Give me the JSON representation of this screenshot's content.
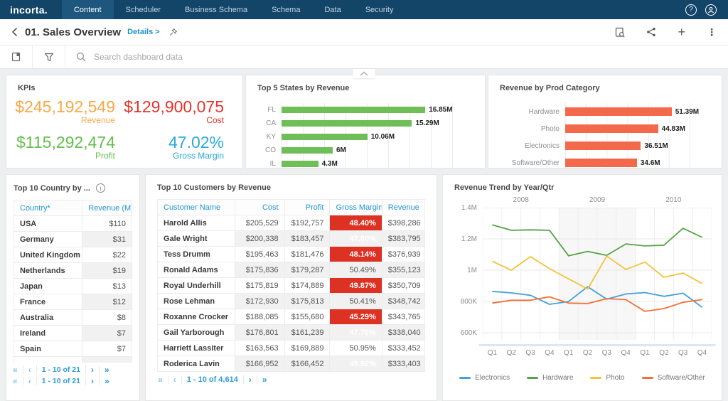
{
  "nav": {
    "logo": "incorta.",
    "items": [
      {
        "label": "Content",
        "active": true
      },
      {
        "label": "Scheduler",
        "active": false
      },
      {
        "label": "Business Schema",
        "active": false
      },
      {
        "label": "Schema",
        "active": false
      },
      {
        "label": "Data",
        "active": false
      },
      {
        "label": "Security",
        "active": false
      }
    ]
  },
  "icons": {
    "help_glyph": "?",
    "add_glyph": "+",
    "more_glyph": "⋮",
    "info_glyph": "i",
    "collapse_direction": "up"
  },
  "header": {
    "title": "01. Sales Overview",
    "details_label": "Details >"
  },
  "toolbar": {
    "search_placeholder": "Search dashboard data"
  },
  "kpis": {
    "title": "KPIs",
    "items": [
      {
        "value": "$245,192,549",
        "label": "Revenue",
        "color": "#F9A845"
      },
      {
        "value": "$129,900,075",
        "label": "Cost",
        "color": "#E63229"
      },
      {
        "value": "$115,292,474",
        "label": "Profit",
        "color": "#63BE4A"
      },
      {
        "value": "47.02%",
        "label": "Gross Margin",
        "color": "#29A8E0"
      }
    ]
  },
  "country_panel": {
    "title": "Top 10 Country by ...",
    "headers": [
      "Country*",
      "Revenue (M)"
    ],
    "rows": [
      [
        "USA",
        "$110"
      ],
      [
        "Germany",
        "$31"
      ],
      [
        "United Kingdom",
        "$22"
      ],
      [
        "Netherlands",
        "$19"
      ],
      [
        "Japan",
        "$13"
      ],
      [
        "France",
        "$12"
      ],
      [
        "Australia",
        "$8"
      ],
      [
        "Ireland",
        "$7"
      ],
      [
        "Spain",
        "$7"
      ]
    ],
    "pagination": [
      "1 - 10 of 21",
      "1 - 10 of 21"
    ]
  },
  "customers_panel": {
    "title": "Top 10 Customers by Revenue",
    "headers": [
      "Customer Name",
      "Cost",
      "Profit",
      "Gross Margin",
      "Revenue"
    ],
    "rows": [
      {
        "name": "Harold Allis",
        "cost": "$205,529",
        "profit": "$192,757",
        "margin": "48.40%",
        "revenue": "$398,286",
        "margin_alert": true
      },
      {
        "name": "Gale Wright",
        "cost": "$200,338",
        "profit": "$183,457",
        "margin": "47.80%",
        "revenue": "$383,795",
        "margin_alert": true
      },
      {
        "name": "Tess Drumm",
        "cost": "$195,463",
        "profit": "$181,476",
        "margin": "48.14%",
        "revenue": "$376,939",
        "margin_alert": true
      },
      {
        "name": "Ronald Adams",
        "cost": "$175,836",
        "profit": "$179,287",
        "margin": "50.49%",
        "revenue": "$355,123",
        "margin_alert": false
      },
      {
        "name": "Royal Underhill",
        "cost": "$175,819",
        "profit": "$174,889",
        "margin": "49.87%",
        "revenue": "$350,709",
        "margin_alert": true
      },
      {
        "name": "Rose Lehman",
        "cost": "$172,930",
        "profit": "$175,813",
        "margin": "50.41%",
        "revenue": "$348,742",
        "margin_alert": false
      },
      {
        "name": "Roxanne Crocker",
        "cost": "$188,085",
        "profit": "$155,680",
        "margin": "45.29%",
        "revenue": "$343,765",
        "margin_alert": true
      },
      {
        "name": "Gail Yarborough",
        "cost": "$176,801",
        "profit": "$161,239",
        "margin": "47.70%",
        "revenue": "$338,040",
        "margin_alert": true
      },
      {
        "name": "Harriett Lassiter",
        "cost": "$163,563",
        "profit": "$169,889",
        "margin": "50.95%",
        "revenue": "$333,452",
        "margin_alert": false
      },
      {
        "name": "Roderica Lavin",
        "cost": "$166,952",
        "profit": "$166,452",
        "margin": "49.92%",
        "revenue": "$333,403",
        "margin_alert": true
      }
    ],
    "pagination": "1 - 10 of 4,614"
  },
  "pagination_glyphs": {
    "first": "«",
    "prev": "‹",
    "next": "›",
    "last": "»"
  },
  "colors": {
    "alert_red": "#dd3223",
    "link_blue": "#2196d3"
  },
  "chart_data": [
    {
      "type": "bar",
      "orientation": "horizontal",
      "title": "Top 5 States by Revenue",
      "categories": [
        "FL",
        "CA",
        "KY",
        "CO",
        "IL"
      ],
      "values": [
        16.85,
        15.29,
        10.06,
        6,
        4.3
      ],
      "value_labels": [
        "16.85M",
        "15.29M",
        "10.06M",
        "6M",
        "4.3M"
      ],
      "xlabel": "",
      "ylabel": "",
      "xlim": [
        0,
        22.5
      ],
      "grid_cells": 9,
      "bar_color": "#6FBE58",
      "grid": true,
      "legend": false
    },
    {
      "type": "bar",
      "orientation": "horizontal",
      "title": "Revenue by Prod Category",
      "categories": [
        "Hardware",
        "Photo",
        "Electronics",
        "Software/Other"
      ],
      "values": [
        51.39,
        44.83,
        36.51,
        34.6
      ],
      "value_labels": [
        "51.39M",
        "44.83M",
        "36.51M",
        "34.6M"
      ],
      "xlabel": "",
      "ylabel": "",
      "xlim": [
        0,
        70
      ],
      "grid_cells": 7,
      "bar_color": "#F4694B",
      "grid": true,
      "legend": false
    },
    {
      "type": "line",
      "title": "Revenue Trend by Year/Qtr",
      "year_groups": [
        "2008",
        "2009",
        "2010"
      ],
      "x_labels": [
        "Q1",
        "Q2",
        "Q3",
        "Q4",
        "Q1",
        "Q2",
        "Q3",
        "Q4",
        "Q1",
        "Q2",
        "Q3",
        "Q4"
      ],
      "y_ticks": [
        {
          "label": "1.4M",
          "value": 1400
        },
        {
          "label": "1.2M",
          "value": 1200
        },
        {
          "label": "1M",
          "value": 1000
        },
        {
          "label": "800K",
          "value": 800
        },
        {
          "label": "600K",
          "value": 600
        }
      ],
      "ylim_k": [
        555,
        1400
      ],
      "shaded_band_columns": [
        4,
        8
      ],
      "legend_position": "bottom",
      "grid": true,
      "series": [
        {
          "name": "Electronics",
          "color": "#41A1D9",
          "values_k": [
            865,
            855,
            840,
            782,
            800,
            895,
            815,
            848,
            857,
            833,
            853,
            763
          ]
        },
        {
          "name": "Hardware",
          "color": "#55A344",
          "values_k": [
            1290,
            1255,
            1258,
            1255,
            1092,
            1120,
            1095,
            1168,
            1155,
            1160,
            1268,
            1210
          ]
        },
        {
          "name": "Photo",
          "color": "#F5C23D",
          "values_k": [
            1057,
            1000,
            1087,
            1010,
            945,
            880,
            1090,
            1005,
            1052,
            955,
            982,
            915
          ]
        },
        {
          "name": "Software/Other",
          "color": "#F07036",
          "values_k": [
            790,
            808,
            808,
            830,
            790,
            787,
            818,
            812,
            737,
            755,
            795,
            812
          ]
        }
      ]
    }
  ]
}
